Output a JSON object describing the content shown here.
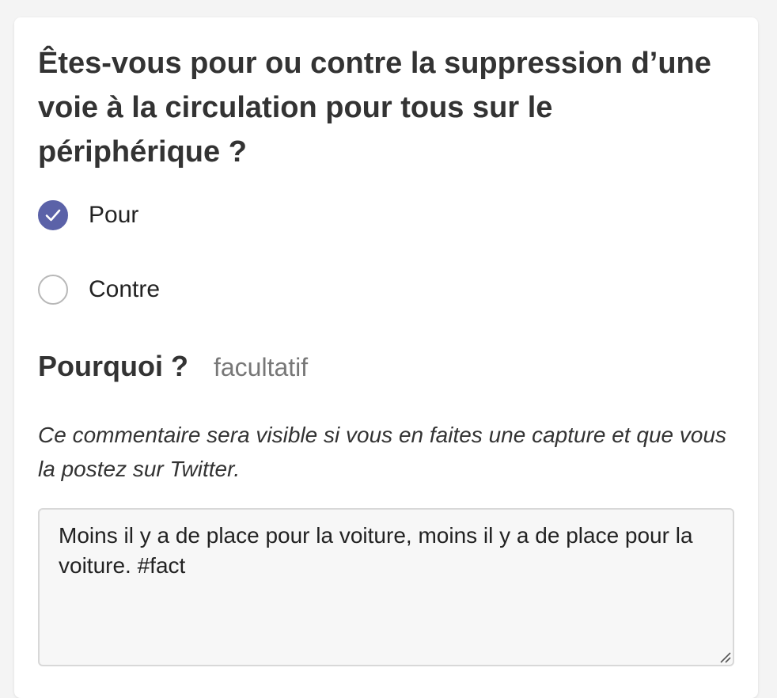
{
  "question": {
    "title": "Êtes-vous pour ou contre la suppression d’une voie à la circulation pour tous sur le périphérique ?"
  },
  "options": [
    {
      "label": "Pour",
      "selected": true,
      "icon": "check-icon"
    },
    {
      "label": "Contre",
      "selected": false
    }
  ],
  "comment": {
    "title": "Pourquoi ?",
    "optional_label": "facultatif",
    "hint": "Ce commentaire sera visible si vous en faites une capture et que vous la postez sur Twitter.",
    "value": "Moins il y a de place pour la voiture, moins il y a de place pour la voiture. #fact"
  },
  "colors": {
    "accent": "#5b62a8",
    "text": "#333333",
    "muted": "#777777",
    "background": "#f4f4f4",
    "card": "#ffffff",
    "field_background": "#f7f7f7"
  }
}
